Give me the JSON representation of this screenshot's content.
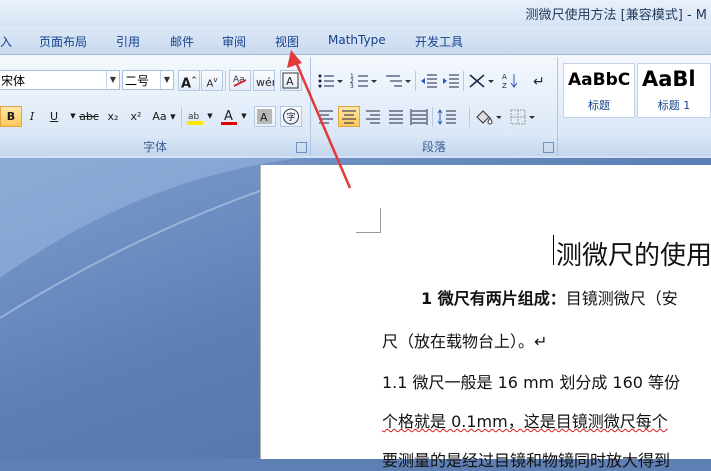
{
  "window": {
    "title": "测微尺使用方法 [兼容模式] - M"
  },
  "tabs": [
    "入",
    "页面布局",
    "引用",
    "邮件",
    "审阅",
    "视图",
    "MathType",
    "开发工具"
  ],
  "font_group": {
    "font_name": "宋体",
    "font_size": "二号",
    "grow_label": "A",
    "shrink_label": "A",
    "label": "字体",
    "bold": "B",
    "italic": "I",
    "underline": "U",
    "strike": "abc",
    "sub": "x₂",
    "sup": "x²",
    "case": "Aa"
  },
  "paragraph_group": {
    "label": "段落"
  },
  "styles": [
    {
      "sample": "AaBbC",
      "name": "标题"
    },
    {
      "sample": "AaBl",
      "name": "标题 1"
    }
  ],
  "document": {
    "title": "测微尺的使用",
    "lines": [
      {
        "bold": "1 微尺有两片组成：",
        "text": "目镜测微尺（安"
      },
      {
        "text": "尺（放在载物台上）。↵"
      },
      {
        "text": "1.1 微尺一般是 16 mm 划分成 160 等份"
      },
      {
        "text": "个格就是 0.1mm，这是目镜测微尺每个"
      },
      {
        "text": "要测量的是经过目镜和物镜同时放大得到"
      }
    ]
  },
  "colors": {
    "accent_arrow": "#e23a3a",
    "highlight": "#ffe600",
    "font_color": "#e00000"
  }
}
